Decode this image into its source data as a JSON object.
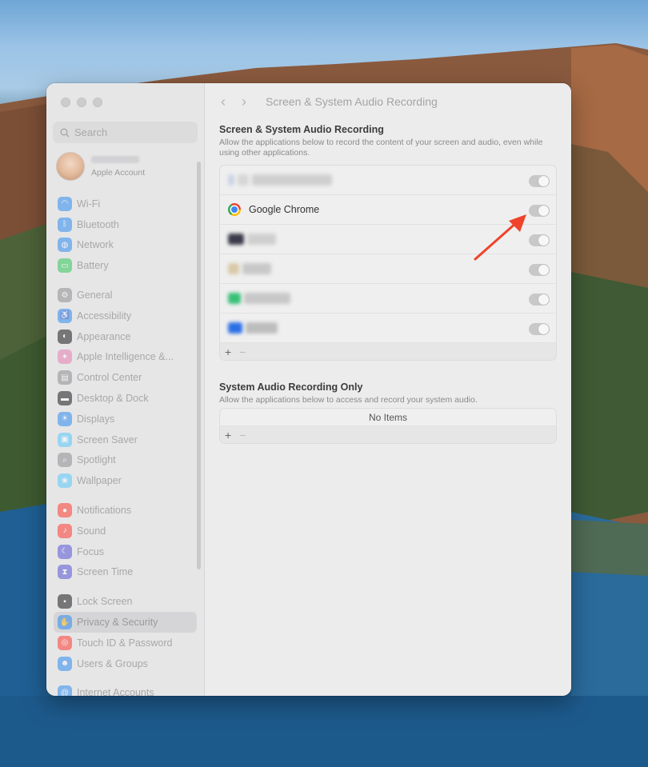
{
  "window": {
    "toolbar_title": "Screen & System Audio Recording",
    "back_glyph": "‹",
    "forward_glyph": "›"
  },
  "search": {
    "placeholder": "Search"
  },
  "account": {
    "subtitle": "Apple Account"
  },
  "sidebar": {
    "groups": [
      [
        {
          "label": "Wi-Fi",
          "icon": "wifi-icon",
          "color": "#2f8cf0"
        },
        {
          "label": "Bluetooth",
          "icon": "bluetooth-icon",
          "color": "#2f8cf0"
        },
        {
          "label": "Network",
          "icon": "globe-icon",
          "color": "#2f8cf0"
        },
        {
          "label": "Battery",
          "icon": "battery-icon",
          "color": "#34c759"
        }
      ],
      [
        {
          "label": "General",
          "icon": "gear-icon",
          "color": "#8e8e93"
        },
        {
          "label": "Accessibility",
          "icon": "accessibility-icon",
          "color": "#2f8cf0"
        },
        {
          "label": "Appearance",
          "icon": "appearance-icon",
          "color": "#1c1c1e"
        },
        {
          "label": "Apple Intelligence &...",
          "icon": "apple-intelligence-icon",
          "color": "#e77fb0"
        },
        {
          "label": "Control Center",
          "icon": "control-center-icon",
          "color": "#8e8e93"
        },
        {
          "label": "Desktop & Dock",
          "icon": "desktop-dock-icon",
          "color": "#1c1c1e"
        },
        {
          "label": "Displays",
          "icon": "displays-icon",
          "color": "#2f8cf0"
        },
        {
          "label": "Screen Saver",
          "icon": "screen-saver-icon",
          "color": "#5ac8fa"
        },
        {
          "label": "Spotlight",
          "icon": "spotlight-icon",
          "color": "#8e8e93"
        },
        {
          "label": "Wallpaper",
          "icon": "wallpaper-icon",
          "color": "#5ac8fa"
        }
      ],
      [
        {
          "label": "Notifications",
          "icon": "notifications-icon",
          "color": "#ff3b30"
        },
        {
          "label": "Sound",
          "icon": "sound-icon",
          "color": "#ff3b30"
        },
        {
          "label": "Focus",
          "icon": "focus-icon",
          "color": "#5856d6"
        },
        {
          "label": "Screen Time",
          "icon": "screen-time-icon",
          "color": "#5856d6"
        }
      ],
      [
        {
          "label": "Lock Screen",
          "icon": "lock-icon",
          "color": "#1c1c1e"
        },
        {
          "label": "Privacy & Security",
          "icon": "hand-icon",
          "color": "#2f8cf0",
          "selected": true
        },
        {
          "label": "Touch ID & Password",
          "icon": "fingerprint-icon",
          "color": "#ff3b30"
        },
        {
          "label": "Users & Groups",
          "icon": "users-icon",
          "color": "#2f8cf0"
        }
      ],
      [
        {
          "label": "Internet Accounts",
          "icon": "at-icon",
          "color": "#2f8cf0"
        }
      ]
    ]
  },
  "screen_recording": {
    "title": "Screen & System Audio Recording",
    "description": "Allow the applications below to record the content of your screen and audio, even while using other applications.",
    "apps": [
      {
        "label": "",
        "redacted": true,
        "enabled": true
      },
      {
        "label": "Google Chrome",
        "icon": "chrome-icon",
        "redacted": false,
        "enabled": true
      },
      {
        "label": "",
        "redacted": true,
        "enabled": true
      },
      {
        "label": "",
        "redacted": true,
        "enabled": true
      },
      {
        "label": "",
        "redacted": true,
        "enabled": true
      },
      {
        "label": "",
        "redacted": true,
        "enabled": true
      }
    ],
    "add_glyph": "+",
    "remove_glyph": "−"
  },
  "audio_only": {
    "title": "System Audio Recording Only",
    "description": "Allow the applications below to access and record your system audio.",
    "empty_label": "No Items",
    "add_glyph": "+",
    "remove_glyph": "−"
  },
  "annotation": {
    "arrow_color": "#f0432a"
  }
}
